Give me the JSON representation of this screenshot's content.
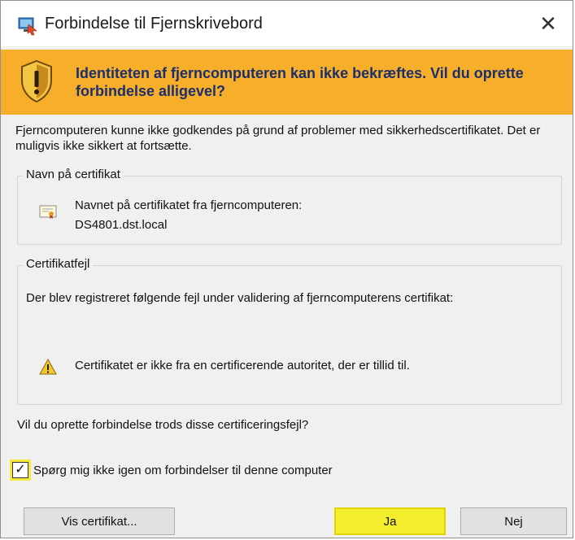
{
  "window": {
    "title": "Forbindelse til Fjernskrivebord",
    "close_glyph": "✕",
    "icon": "remote-desktop-icon"
  },
  "banner": {
    "text": "Identiteten af fjerncomputeren kan ikke bekræftes. Vil du oprette forbindelse alligevel?",
    "icon": "shield-warning-icon",
    "color": "#f6ae2b"
  },
  "intro": "Fjerncomputeren kunne ikke godkendes på grund af problemer med sikkerhedscertifikatet. Det er muligvis ikke sikkert at fortsætte.",
  "cert_group": {
    "legend": "Navn på certifikat",
    "label": "Navnet på certifikatet fra fjerncomputeren:",
    "value": "DS4801.dst.local",
    "icon": "certificate-icon"
  },
  "error_group": {
    "legend": "Certifikatfejl",
    "description": "Der blev registreret følgende fejl under validering af fjerncomputerens certifikat:",
    "items": [
      {
        "icon": "warning-icon",
        "text": "Certifikatet er ikke fra en certificerende autoritet, der er tillid til."
      }
    ]
  },
  "question": "Vil du oprette forbindelse trods disse certificeringsfejl?",
  "checkbox": {
    "label": "Spørg mig ikke igen om forbindelser til denne computer",
    "checked": true,
    "check_glyph": "✓"
  },
  "buttons": {
    "view_cert": "Vis certifikat...",
    "yes": "Ja",
    "no": "Nej"
  },
  "colors": {
    "highlight": "#f5ee2c",
    "banner_text": "#1b2f6b"
  }
}
